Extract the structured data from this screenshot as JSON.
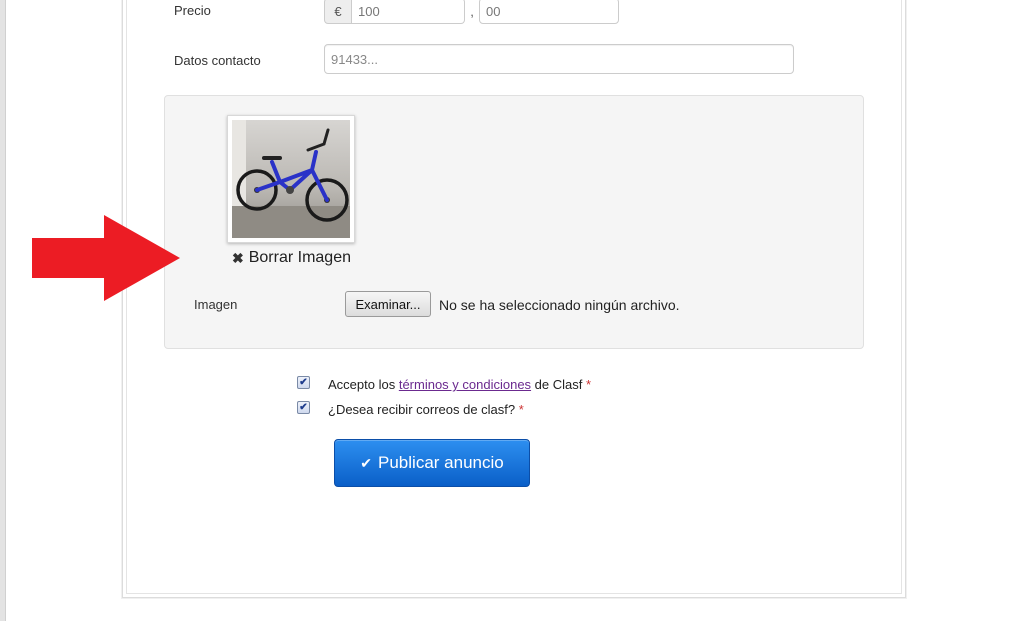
{
  "form": {
    "price_label": "Precio",
    "currency_symbol": "€",
    "price_integer_value": "100",
    "price_separator": ",",
    "price_decimal_value": "00",
    "contact_label": "Datos contacto",
    "contact_value": "91433..."
  },
  "image_section": {
    "delete_image_label": "Borrar Imagen",
    "file_field_label": "Imagen",
    "browse_button_label": "Examinar...",
    "file_status": "No se ha seleccionado ningún archivo."
  },
  "terms": {
    "accept_prefix": "Accepto los ",
    "accept_link": "términos y condiciones",
    "accept_suffix": " de Clasf",
    "accept_checked": true,
    "newsletter_label": "¿Desea recibir correos de clasf?",
    "newsletter_checked": true,
    "required_marker": "*"
  },
  "actions": {
    "publish_label": "Publicar anuncio"
  },
  "colors": {
    "publish_button": "#0a5fc8",
    "annotation_arrow": "#ec1c24",
    "link": "#6b2a8f"
  },
  "icons": {
    "delete": "close-icon",
    "publish": "check-icon",
    "annotation": "arrow-right-icon"
  }
}
